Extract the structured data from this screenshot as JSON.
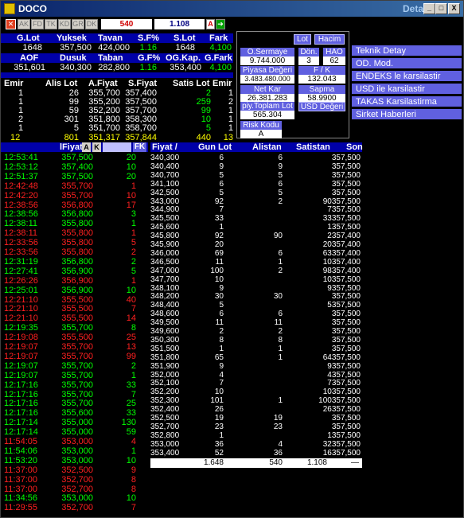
{
  "window": {
    "title": "DOCO",
    "title_right": "Detay",
    "min": "_",
    "max": "□",
    "close": "X"
  },
  "toolbar": {
    "buttons": [
      "AK",
      "FD",
      "TK",
      "KD",
      "GR",
      "DK"
    ],
    "field1": "540",
    "field2": "1.108",
    "letter_a": "A",
    "arrow": "➔"
  },
  "summary": {
    "hdr1": [
      "G.Lot",
      "Yuksek",
      "Tavan",
      "S.F%",
      "S.Lot",
      "Fark"
    ],
    "row1": [
      "1648",
      "357,500",
      "424,000",
      "1.16",
      "1648",
      "4,100"
    ],
    "hdr2": [
      "AOF",
      "Dusuk",
      "Taban",
      "G.F%",
      "OG.Kap.",
      "G.Fark"
    ],
    "row2": [
      "351,601",
      "340,300",
      "282,800",
      "1.16",
      "353,400",
      "4,100"
    ]
  },
  "depth": {
    "headers": [
      "Emir",
      "Alis Lot",
      "A.Fiyat",
      "S.Fiyat",
      "Satis Lot",
      "Emir"
    ],
    "rows": [
      [
        "1",
        "26",
        "355,700",
        "357,400",
        "2",
        "1"
      ],
      [
        "1",
        "99",
        "355,200",
        "357,500",
        "259",
        "2"
      ],
      [
        "1",
        "59",
        "352,200",
        "357,700",
        "99",
        "1"
      ],
      [
        "2",
        "301",
        "351,800",
        "358,300",
        "10",
        "1"
      ],
      [
        "1",
        "5",
        "351,700",
        "358,700",
        "5",
        "1"
      ]
    ],
    "total": [
      "12",
      "801",
      "351,317",
      "357,844",
      "440",
      "13"
    ]
  },
  "panel": {
    "btn_lot": "Lot",
    "btn_hacim": "Hacim",
    "o_sermaye_label": "O.Sermaye",
    "o_sermaye": "9.744.000",
    "don_label": "Dön.",
    "don": "3",
    "hao_label": "HAO",
    "hao": "62",
    "piyasa_label": "Piyasa Değeri",
    "piyasa": "3.483.480.000",
    "fk_label": "F / K",
    "fk": "132.043",
    "netkar_label": "Net Kar",
    "netkar": "26.381.283",
    "sapma_label": "Sapma",
    "sapma": "58.9900",
    "piy_label": "piy.Toplam Lot",
    "piy": "565.304",
    "usd_label": "USD Değeri",
    "risk_label": "Risk Kodu",
    "risk": "A"
  },
  "menu": [
    "Teknik Detay",
    "OD. Mod.",
    "ENDEKS le karsilastir",
    "USD ile karsilastir",
    "TAKAS Karsilastirma",
    "Sirket Haberleri"
  ],
  "trades": {
    "headers": [
      "lFiyat",
      "A",
      "K",
      "FK"
    ],
    "rows": [
      [
        "12:53:41",
        "357,500",
        "20",
        "g"
      ],
      [
        "12:53:12",
        "357,400",
        "10",
        "g"
      ],
      [
        "12:51:37",
        "357,500",
        "20",
        "g"
      ],
      [
        "12:42:48",
        "355,700",
        "1",
        "r"
      ],
      [
        "12:42:20",
        "355,700",
        "10",
        "r"
      ],
      [
        "12:38:56",
        "356,800",
        "17",
        "r"
      ],
      [
        "12:38:56",
        "356,800",
        "3",
        "g"
      ],
      [
        "12:38:11",
        "355,800",
        "1",
        "g"
      ],
      [
        "12:38:11",
        "355,800",
        "1",
        "r"
      ],
      [
        "12:33:56",
        "355,800",
        "5",
        "r"
      ],
      [
        "12:33:56",
        "355,800",
        "2",
        "r"
      ],
      [
        "12:31:19",
        "356,800",
        "2",
        "g"
      ],
      [
        "12:27:41",
        "356,900",
        "5",
        "g"
      ],
      [
        "12:26:26",
        "356,900",
        "1",
        "r"
      ],
      [
        "12:25:01",
        "356,900",
        "10",
        "g"
      ],
      [
        "12:21:10",
        "355,500",
        "40",
        "r"
      ],
      [
        "12:21:10",
        "355,500",
        "7",
        "r"
      ],
      [
        "12:21:10",
        "355,500",
        "14",
        "r"
      ],
      [
        "12:19:35",
        "355,700",
        "8",
        "g"
      ],
      [
        "12:19:08",
        "355,500",
        "25",
        "r"
      ],
      [
        "12:19:07",
        "355,700",
        "13",
        "r"
      ],
      [
        "12:19:07",
        "355,700",
        "99",
        "r"
      ],
      [
        "12:19:07",
        "355,700",
        "2",
        "g"
      ],
      [
        "12:19:07",
        "355,700",
        "1",
        "g"
      ],
      [
        "12:17:16",
        "355,700",
        "33",
        "g"
      ],
      [
        "12:17:16",
        "355,700",
        "7",
        "g"
      ],
      [
        "12:17:16",
        "355,700",
        "25",
        "g"
      ],
      [
        "12:17:16",
        "355,600",
        "33",
        "g"
      ],
      [
        "12:17:14",
        "355,000",
        "130",
        "g"
      ],
      [
        "12:17:14",
        "355,000",
        "59",
        "g"
      ],
      [
        "11:54:05",
        "353,000",
        "4",
        "r"
      ],
      [
        "11:54:06",
        "353,000",
        "1",
        "g"
      ],
      [
        "11:53:20",
        "353,000",
        "10",
        "g"
      ],
      [
        "11:37:00",
        "352,500",
        "9",
        "r"
      ],
      [
        "11:37:00",
        "352,700",
        "8",
        "r"
      ],
      [
        "11:37:00",
        "352,700",
        "8",
        "r"
      ],
      [
        "11:34:56",
        "353,000",
        "10",
        "g"
      ],
      [
        "11:29:55",
        "352,700",
        "7",
        "r"
      ]
    ]
  },
  "dist": {
    "headers": [
      "Fiyat /",
      "Gun Lot",
      "Alistan",
      "Satistan",
      "Son"
    ],
    "rows": [
      [
        "340,300",
        "6",
        "6",
        "357,500"
      ],
      [
        "340,400",
        "9",
        "9",
        "357,500"
      ],
      [
        "340,700",
        "5",
        "5",
        "357,500"
      ],
      [
        "341,100",
        "6",
        "6",
        "357,500"
      ],
      [
        "342,500",
        "5",
        "5",
        "357,500"
      ],
      [
        "343,000",
        "92",
        "2",
        "90357,500"
      ],
      [
        "344,900",
        "7",
        "",
        "7357,500"
      ],
      [
        "345,500",
        "33",
        "",
        "33357,500"
      ],
      [
        "345,600",
        "1",
        "",
        "1357,500"
      ],
      [
        "345,800",
        "92",
        "90",
        "2357,400"
      ],
      [
        "345,900",
        "20",
        "",
        "20357,400"
      ],
      [
        "346,000",
        "69",
        "6",
        "63357,400"
      ],
      [
        "346,500",
        "11",
        "1",
        "10357,400"
      ],
      [
        "347,000",
        "100",
        "2",
        "98357,400"
      ],
      [
        "347,700",
        "10",
        "",
        "10357,500"
      ],
      [
        "348,100",
        "9",
        "",
        "9357,500"
      ],
      [
        "348,200",
        "30",
        "30",
        "357,500"
      ],
      [
        "348,400",
        "5",
        "",
        "5357,500"
      ],
      [
        "348,600",
        "6",
        "6",
        "357,500"
      ],
      [
        "349,500",
        "11",
        "11",
        "357,500"
      ],
      [
        "349,600",
        "2",
        "2",
        "357,500"
      ],
      [
        "350,300",
        "8",
        "8",
        "357,500"
      ],
      [
        "351,500",
        "1",
        "1",
        "357,500"
      ],
      [
        "351,800",
        "65",
        "1",
        "64357,500"
      ],
      [
        "351,900",
        "9",
        "",
        "9357,500"
      ],
      [
        "352,000",
        "4",
        "",
        "4357,500"
      ],
      [
        "352,100",
        "7",
        "",
        "7357,500"
      ],
      [
        "352,200",
        "10",
        "",
        "10357,500"
      ],
      [
        "352,300",
        "101",
        "1",
        "100357,500"
      ],
      [
        "352,400",
        "26",
        "",
        "26357,500"
      ],
      [
        "352,500",
        "19",
        "19",
        "357,500"
      ],
      [
        "352,700",
        "23",
        "23",
        "357,500"
      ],
      [
        "352,800",
        "1",
        "",
        "1357,500"
      ],
      [
        "353,000",
        "36",
        "4",
        "32357,500"
      ],
      [
        "353,400",
        "52",
        "36",
        "16357,500"
      ]
    ],
    "total": [
      "1.648",
      "540",
      "1.108",
      "—"
    ]
  }
}
